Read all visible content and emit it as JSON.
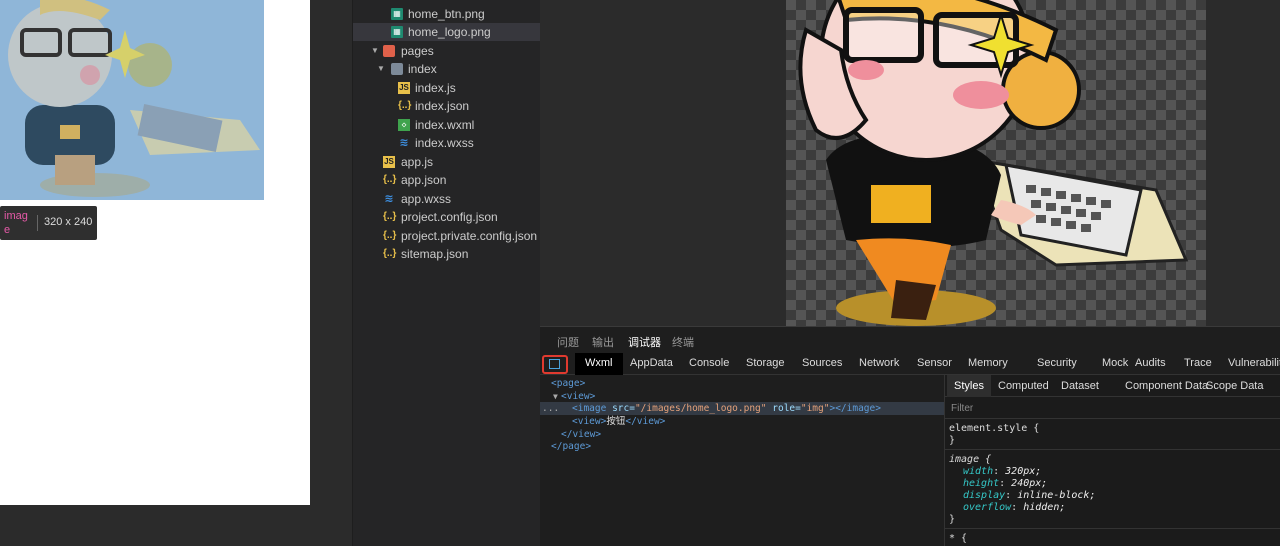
{
  "simulator": {
    "tooltip_tag": "image",
    "tooltip_size": "320 x 240"
  },
  "file_tree": [
    {
      "name": "home_btn.png",
      "type": "img"
    },
    {
      "name": "home_logo.png",
      "type": "img",
      "selected": true
    },
    {
      "name": "pages",
      "type": "folder-red",
      "expanded": true
    },
    {
      "name": "index",
      "type": "folder-grey",
      "expanded": true
    },
    {
      "name": "index.js",
      "type": "js"
    },
    {
      "name": "index.json",
      "type": "json"
    },
    {
      "name": "index.wxml",
      "type": "wxml"
    },
    {
      "name": "index.wxss",
      "type": "wxss"
    },
    {
      "name": "app.js",
      "type": "js"
    },
    {
      "name": "app.json",
      "type": "json"
    },
    {
      "name": "app.wxss",
      "type": "wxss"
    },
    {
      "name": "project.config.json",
      "type": "json"
    },
    {
      "name": "project.private.config.json",
      "type": "json"
    },
    {
      "name": "sitemap.json",
      "type": "json"
    }
  ],
  "devtools": {
    "top_tabs": [
      "问题",
      "输出",
      "调试器",
      "终端"
    ],
    "active_top_tab": "调试器",
    "panel_tabs": [
      "Wxml",
      "AppData",
      "Console",
      "Storage",
      "Sources",
      "Network",
      "Sensor",
      "Memory",
      "Security",
      "Mock",
      "Audits",
      "Trace",
      "Vulnerability"
    ],
    "active_panel_tab": "Wxml",
    "wxml": {
      "page_open": "<page>",
      "view_open": "<view>",
      "image_tag": "<image",
      "image_src_attr": "src=",
      "image_src_val": "\"/images/home_logo.png\"",
      "image_role_attr": "role=",
      "image_role_val": "\"img\"",
      "image_close": "></image>",
      "inner_view_open": "<view>",
      "inner_view_text": "按钮",
      "inner_view_close": "</view>",
      "view_close": "</view>",
      "page_close": "</page>",
      "ellipsis": "..."
    },
    "style_tabs": [
      "Styles",
      "Computed",
      "Dataset",
      "Component Data",
      "Scope Data"
    ],
    "active_style_tab": "Styles",
    "filter_placeholder": "Filter",
    "rules": {
      "element_style_selector": "element.style {",
      "close_brace": "}",
      "image_selector": "image {",
      "props": [
        {
          "name": "width",
          "value": "320px;"
        },
        {
          "name": "height",
          "value": "240px;"
        },
        {
          "name": "display",
          "value": "inline-block;"
        },
        {
          "name": "overflow",
          "value": "hidden;"
        }
      ],
      "star_selector": "* {"
    }
  }
}
